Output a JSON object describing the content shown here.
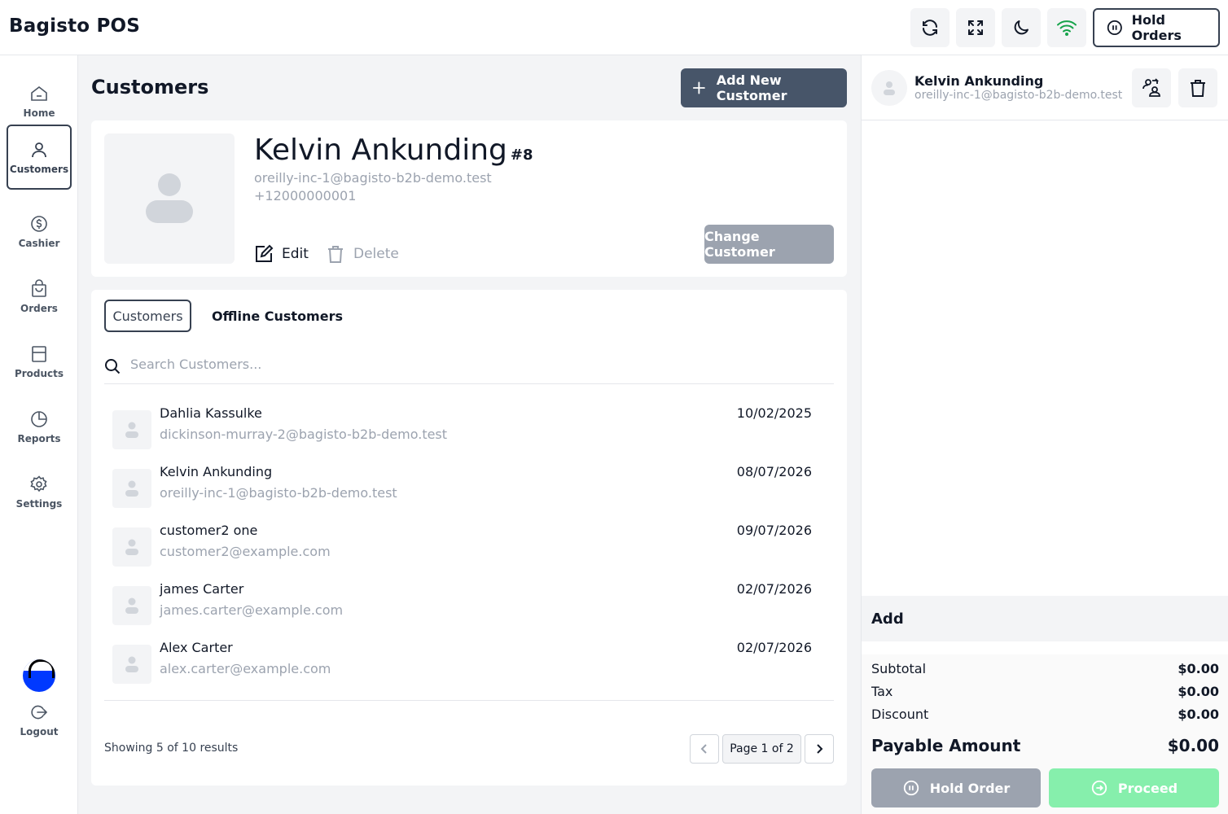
{
  "header": {
    "brand": "Bagisto POS",
    "hold_orders_label": "Hold Orders"
  },
  "sidebar": {
    "items": [
      {
        "label": "Home",
        "icon": "home-icon"
      },
      {
        "label": "Customers",
        "icon": "user-icon",
        "active": true
      },
      {
        "label": "Cashier",
        "icon": "dollar-icon"
      },
      {
        "label": "Orders",
        "icon": "bag-icon"
      },
      {
        "label": "Products",
        "icon": "box-icon"
      },
      {
        "label": "Reports",
        "icon": "pie-chart-icon"
      },
      {
        "label": "Settings",
        "icon": "gear-icon"
      }
    ],
    "logout_label": "Logout"
  },
  "main": {
    "title": "Customers",
    "add_button_label": "Add New Customer",
    "profile": {
      "name": "Kelvin Ankunding",
      "id": "#8",
      "email": "oreilly-inc-1@bagisto-b2b-demo.test",
      "phone": "+12000000001",
      "edit_label": "Edit",
      "delete_label": "Delete",
      "change_label": "Change Customer"
    },
    "tabs": [
      {
        "label": "Customers",
        "active": true
      },
      {
        "label": "Offline Customers",
        "active": false
      }
    ],
    "search_placeholder": "Search Customers...",
    "customers": [
      {
        "name": "Dahlia Kassulke",
        "email": "dickinson-murray-2@bagisto-b2b-demo.test",
        "date": "10/02/2025"
      },
      {
        "name": "Kelvin Ankunding",
        "email": "oreilly-inc-1@bagisto-b2b-demo.test",
        "date": "08/07/2026"
      },
      {
        "name": "customer2 one",
        "email": "customer2@example.com",
        "date": "09/07/2026"
      },
      {
        "name": "james Carter",
        "email": "james.carter@example.com",
        "date": "02/07/2026"
      },
      {
        "name": "Alex Carter",
        "email": "alex.carter@example.com",
        "date": "02/07/2026"
      }
    ],
    "showing_text": "Showing 5 of 10 results",
    "page_label": "Page 1 of 2"
  },
  "cart": {
    "customer_name": "Kelvin Ankunding",
    "customer_email": "oreilly-inc-1@bagisto-b2b-demo.test",
    "add_label": "Add",
    "subtotal_label": "Subtotal",
    "subtotal": "$0.00",
    "tax_label": "Tax",
    "tax": "$0.00",
    "discount_label": "Discount",
    "discount": "$0.00",
    "payable_label": "Payable Amount",
    "payable": "$0.00",
    "hold_order_label": "Hold Order",
    "proceed_label": "Proceed"
  },
  "colors": {
    "accent": "#475569",
    "wifi": "#16a34a",
    "proceed": "#86efac"
  }
}
